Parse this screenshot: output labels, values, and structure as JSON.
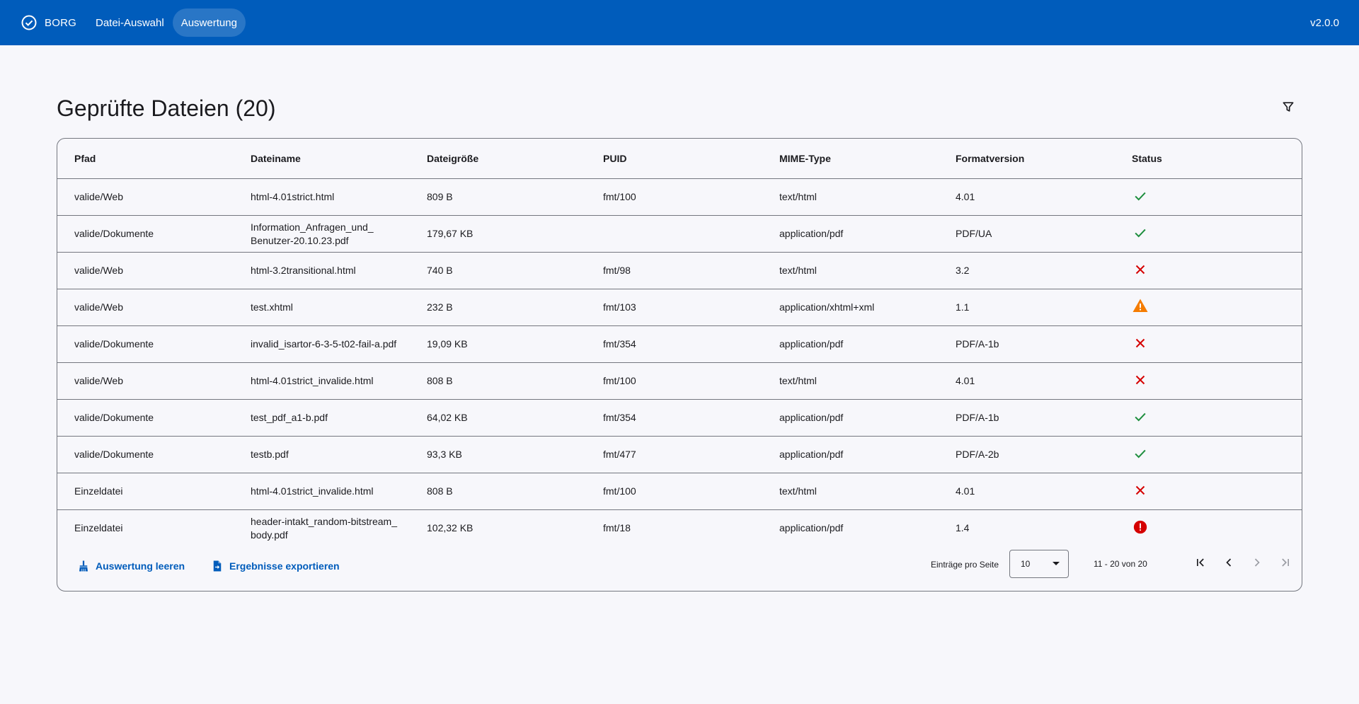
{
  "app": {
    "brand": "BORG",
    "version": "v2.0.0",
    "nav": [
      {
        "label": "Datei-Auswahl",
        "active": false
      },
      {
        "label": "Auswertung",
        "active": true
      }
    ],
    "accent_color": "#005cbb"
  },
  "page": {
    "title": "Geprüfte Dateien (20)",
    "filter_icon": "filter-icon"
  },
  "table": {
    "columns": [
      "Pfad",
      "Dateiname",
      "Dateigröße",
      "PUID",
      "MIME-Type",
      "Formatversion",
      "Status"
    ],
    "rows": [
      {
        "path": "valide/Web",
        "name": "html-4.01strict.html",
        "size": "809 B",
        "puid": "fmt/100",
        "mime": "text/html",
        "version": "4.01",
        "status": "valid"
      },
      {
        "path": "valide/Dokumente",
        "name": "Information_Anfragen_und_\nBenutzer-20.10.23.pdf",
        "size": "179,67 KB",
        "puid": "",
        "mime": "application/pdf",
        "version": "PDF/UA",
        "status": "valid"
      },
      {
        "path": "valide/Web",
        "name": "html-3.2transitional.html",
        "size": "740 B",
        "puid": "fmt/98",
        "mime": "text/html",
        "version": "3.2",
        "status": "invalid"
      },
      {
        "path": "valide/Web",
        "name": "test.xhtml",
        "size": "232 B",
        "puid": "fmt/103",
        "mime": "application/xhtml+xml",
        "version": "1.1",
        "status": "warning"
      },
      {
        "path": "valide/Dokumente",
        "name": "invalid_isartor-6-3-5-t02-fail-a.pdf",
        "size": "19,09 KB",
        "puid": "fmt/354",
        "mime": "application/pdf",
        "version": "PDF/A-1b",
        "status": "invalid"
      },
      {
        "path": "valide/Web",
        "name": "html-4.01strict_invalide.html",
        "size": "808 B",
        "puid": "fmt/100",
        "mime": "text/html",
        "version": "4.01",
        "status": "invalid"
      },
      {
        "path": "valide/Dokumente",
        "name": "test_pdf_a1-b.pdf",
        "size": "64,02 KB",
        "puid": "fmt/354",
        "mime": "application/pdf",
        "version": "PDF/A-1b",
        "status": "valid"
      },
      {
        "path": "valide/Dokumente",
        "name": "testb.pdf",
        "size": "93,3 KB",
        "puid": "fmt/477",
        "mime": "application/pdf",
        "version": "PDF/A-2b",
        "status": "valid"
      },
      {
        "path": "Einzeldatei",
        "name": "html-4.01strict_invalide.html",
        "size": "808 B",
        "puid": "fmt/100",
        "mime": "text/html",
        "version": "4.01",
        "status": "invalid"
      },
      {
        "path": "Einzeldatei",
        "name": "header-intakt_random-bitstream_\nbody.pdf",
        "size": "102,32 KB",
        "puid": "fmt/18",
        "mime": "application/pdf",
        "version": "1.4",
        "status": "error"
      }
    ],
    "status_colors": {
      "valid": "#1e8e3e",
      "invalid": "#d50000",
      "warning": "#f57c00",
      "error": "#d50000"
    }
  },
  "footer": {
    "clear_label": "Auswertung leeren",
    "export_label": "Ergebnisse exportieren",
    "page_size_label": "Einträge pro Seite",
    "page_size": "10",
    "range": "11 - 20 von 20"
  }
}
